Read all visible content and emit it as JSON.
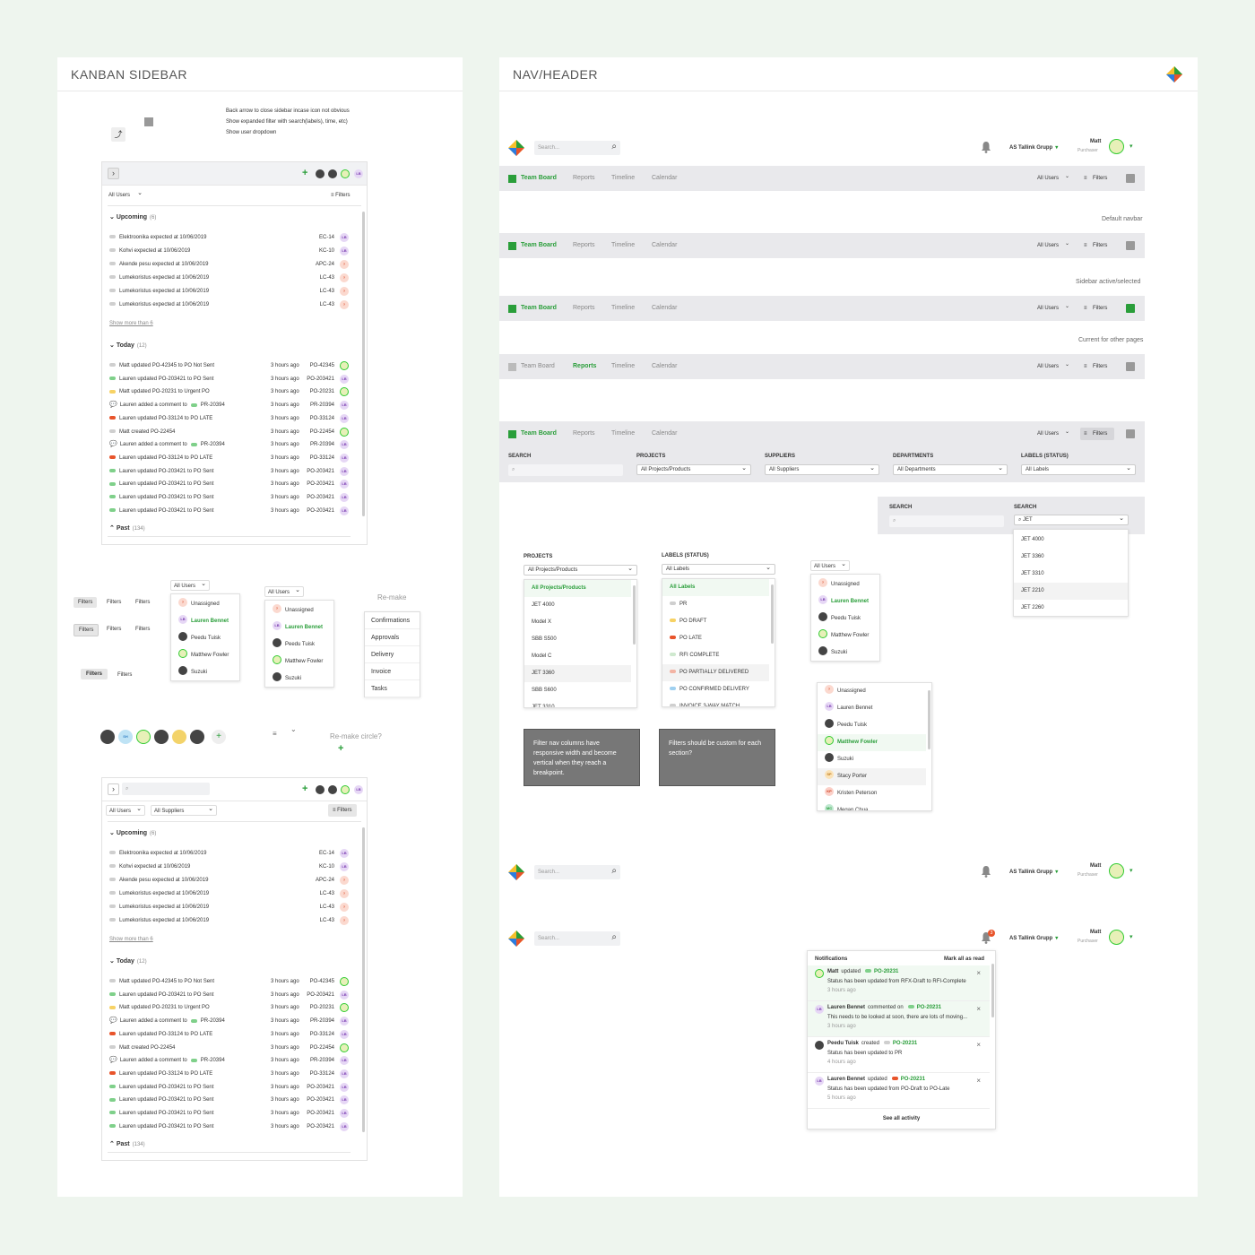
{
  "kanban": {
    "title": "KANBAN SIDEBAR",
    "notes": [
      "Back arrow to close sidebar incase icon not obvious",
      "Show expanded filter with search(labels), time, etc)",
      "Show user dropdown"
    ],
    "all_users": "All Users",
    "all_suppliers": "All Suppliers",
    "filters": "Filters",
    "upcoming": "Upcoming",
    "upcoming_count": "(6)",
    "upcoming_rows": [
      {
        "text": "Elektroonika expected at 10/06/2019",
        "code": "EC-14",
        "av": "LB"
      },
      {
        "text": "Kohvi expected at 10/06/2019",
        "code": "KC-10",
        "av": "LB"
      },
      {
        "text": "Akende pesu expected at 10/06/2019",
        "code": "APC-24",
        "av": "?"
      },
      {
        "text": "Lumekoristus expected at 10/06/2019",
        "code": "LC-43",
        "av": "?"
      },
      {
        "text": "Lumekoristus expected at 10/06/2019",
        "code": "LC-43",
        "av": "?"
      },
      {
        "text": "Lumekoristus expected at 10/06/2019",
        "code": "LC-43",
        "av": "?"
      }
    ],
    "show_more": "Show more than 6",
    "today": "Today",
    "today_count": "(12)",
    "today_rows": [
      {
        "text": "Matt updated PO-42345 to PO Not Sent",
        "time": "3 hours ago",
        "code": "PO-42345",
        "color": "#cfcfcf",
        "av": "M"
      },
      {
        "text": "Lauren updated PO-203421 to PO Sent",
        "time": "3 hours ago",
        "code": "PO-203421",
        "color": "#7fd08a",
        "av": "LB"
      },
      {
        "text": "Matt updated PO-20231 to Urgent PO",
        "time": "3 hours ago",
        "code": "PO-20231",
        "color": "#f7d264",
        "av": "M"
      },
      {
        "text": "Lauren added a comment to",
        "tag": "PR-20394",
        "time": "3 hours ago",
        "code": "PR-20394",
        "color": "comment",
        "av": "LB"
      },
      {
        "text": "Lauren updated PO-33124 to PO LATE",
        "time": "3 hours ago",
        "code": "PO-33124",
        "color": "#e8542b",
        "av": "LB"
      },
      {
        "text": "Matt created PO-22454",
        "time": "3 hours ago",
        "code": "PO-22454",
        "color": "#cfcfcf",
        "av": "M"
      },
      {
        "text": "Lauren added a comment to",
        "tag": "PR-20394",
        "time": "3 hours ago",
        "code": "PR-20394",
        "color": "comment",
        "av": "LB"
      },
      {
        "text": "Lauren updated PO-33124 to PO LATE",
        "time": "3 hours ago",
        "code": "PO-33124",
        "color": "#e8542b",
        "av": "LB"
      },
      {
        "text": "Lauren updated PO-203421 to PO Sent",
        "time": "3 hours ago",
        "code": "PO-203421",
        "color": "#7fd08a",
        "av": "LB"
      },
      {
        "text": "Lauren updated PO-203421 to PO Sent",
        "time": "3 hours ago",
        "code": "PO-203421",
        "color": "#7fd08a",
        "av": "LB"
      },
      {
        "text": "Lauren updated PO-203421 to PO Sent",
        "time": "3 hours ago",
        "code": "PO-203421",
        "color": "#7fd08a",
        "av": "LB"
      },
      {
        "text": "Lauren updated PO-203421 to PO Sent",
        "time": "3 hours ago",
        "code": "PO-203421",
        "color": "#7fd08a",
        "av": "LB"
      }
    ],
    "past": "Past",
    "past_count": "(134)",
    "chips": [
      "Filters",
      "Filters",
      "Filters"
    ],
    "user_options": [
      "Unassigned",
      "Lauren Bennet",
      "Peedu Tuisk",
      "Matthew Fowler",
      "Suzuki"
    ],
    "remake": "Re-make",
    "menu": [
      "Confirmations",
      "Approvals",
      "Delivery",
      "Invoice",
      "Tasks"
    ],
    "remake_circle": "Re-make circle?"
  },
  "nav": {
    "title": "NAV/HEADER",
    "search_placeholder": "Search...",
    "company": "AS Tallink Grupp",
    "user_name": "Matt",
    "user_role": "Purchaser",
    "tabs": [
      "Team Board",
      "Reports",
      "Timeline",
      "Calendar"
    ],
    "all_users": "All Users",
    "filters": "Filters",
    "notes": [
      "Default navbar",
      "Sidebar active/selected",
      "Current for other pages"
    ],
    "filter_labels": [
      "SEARCH",
      "PROJECTS",
      "SUPPLIERS",
      "DEPARTMENTS",
      "LABELS (STATUS)"
    ],
    "filter_values": [
      "All Projects/Products",
      "All Suppliers",
      "All Departments",
      "All Labels"
    ],
    "search_label": "SEARCH",
    "jet_query": "JET",
    "jet_results": [
      "JET 4000",
      "JET 3360",
      "JET 3310",
      "JET 2210",
      "JET 2260"
    ],
    "projects_label": "PROJECTS",
    "projects_value": "All Projects/Products",
    "projects_list": [
      "All Projects/Products",
      "JET 4000",
      "Model X",
      "SBB S500",
      "Model C",
      "JET 3360",
      "SBB S600",
      "JET 3310"
    ],
    "labels_label": "LABELS (STATUS)",
    "labels_value": "All Labels",
    "labels_list": [
      {
        "name": "All Labels",
        "color": ""
      },
      {
        "name": "PR",
        "color": "#cfcfcf"
      },
      {
        "name": "PO DRAFT",
        "color": "#f7d264"
      },
      {
        "name": "PO LATE",
        "color": "#e8542b"
      },
      {
        "name": "RFI COMPLETE",
        "color": "#cfe9cf"
      },
      {
        "name": "PO PARTIALLY DELIVERED",
        "color": "#f3b4a4"
      },
      {
        "name": "PO CONFIRMED DELIVERY",
        "color": "#9fd0f0"
      },
      {
        "name": "INVOICE 3-WAY MATCH",
        "color": "#cfcfcf"
      }
    ],
    "box1": "Filter nav columns have responsive width and become vertical when they reach a breakpoint.",
    "box2": "Filters should be custom for each section?",
    "users_list": [
      {
        "name": "Unassigned",
        "av": "?"
      },
      {
        "name": "Lauren Bennet",
        "av": "LB"
      },
      {
        "name": "Peedu Tuisk",
        "av": "P"
      },
      {
        "name": "Matthew Fowler",
        "av": "M"
      },
      {
        "name": "Suzuki",
        "av": "S"
      },
      {
        "name": "Stacy Porter",
        "av": "SP"
      },
      {
        "name": "Kristen Peterson",
        "av": "KP"
      },
      {
        "name": "Megan Chua",
        "av": "MC"
      }
    ],
    "notifications": "Notifications",
    "mark_all": "Mark all as read",
    "badge": "3",
    "notif_items": [
      {
        "who": "Matt",
        "action": "updated",
        "code": "PO-20231",
        "msg": "Status has been updated from RFX-Draft to RFI-Complete",
        "time": "3 hours ago",
        "av": "M"
      },
      {
        "who": "Lauren Bennet",
        "action": "commented on",
        "code": "PO-20231",
        "msg": "This needs to be looked at soon, there are lots of moving...",
        "time": "3 hours ago",
        "av": "LB"
      },
      {
        "who": "Peedu Tuisk",
        "action": "created",
        "code": "PO-20231",
        "msg": "Status has been updated to PR",
        "time": "4 hours ago",
        "av": "P"
      },
      {
        "who": "Lauren Bennet",
        "action": "updated",
        "code": "PO-20231",
        "msg": "Status has been updated from PO-Draft to PO-Late",
        "time": "5 hours ago",
        "av": "LB"
      }
    ],
    "see_all": "See all activity"
  },
  "colors": {
    "accent": "#2a9e3a",
    "navbar": "#e9e9ec",
    "late": "#e8542b",
    "sent": "#7fd08a"
  }
}
